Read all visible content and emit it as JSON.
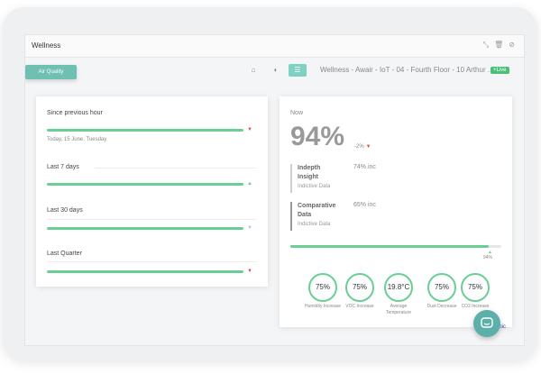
{
  "window": {
    "title": "Wellness"
  },
  "toolbar": {
    "air_quality_tab": "Air Quality",
    "breadcrumb": "Wellness - Awair - IoT - 04 - Fourth Floor - 10 Arthur ...",
    "live_badge": "+Live"
  },
  "left_panel": {
    "periods": [
      {
        "label": "Since previous hour",
        "subtext": "Today, 15 June, Tuesday",
        "trend": "down",
        "trend_glyph": "▼"
      },
      {
        "label": "Last 7 days",
        "trend": "up",
        "trend_glyph": "▲"
      },
      {
        "label": "Last 30 days",
        "trend": "down-light",
        "trend_glyph": "▼"
      },
      {
        "label": "Last Quarter",
        "trend": "down",
        "trend_glyph": "▼"
      }
    ]
  },
  "right_panel": {
    "now_label": "Now",
    "main_value": "94%",
    "delta": "-2%",
    "metrics": [
      {
        "name": "Indepth Insight",
        "value": "74% inc",
        "subtext": "Indictive Data"
      },
      {
        "name": "Comparative Data",
        "value": "65% inc",
        "subtext": "Indictive Data"
      }
    ],
    "progress": {
      "value": 0.94,
      "label": "94%"
    },
    "circles": [
      {
        "value": "75%",
        "label": "Humidity Increase"
      },
      {
        "value": "75%",
        "label": "VOC Increase"
      },
      {
        "value": "19.8°C",
        "label": "Average Temperature"
      },
      {
        "value": "75%",
        "label": "Dust Decrease"
      },
      {
        "value": "75%",
        "label": "CO2 Increase"
      }
    ]
  },
  "footer": {
    "dynamic_text": "namic"
  },
  "colors": {
    "accent": "#69cf93",
    "teal": "#6fbfb3",
    "down": "#e05252"
  }
}
